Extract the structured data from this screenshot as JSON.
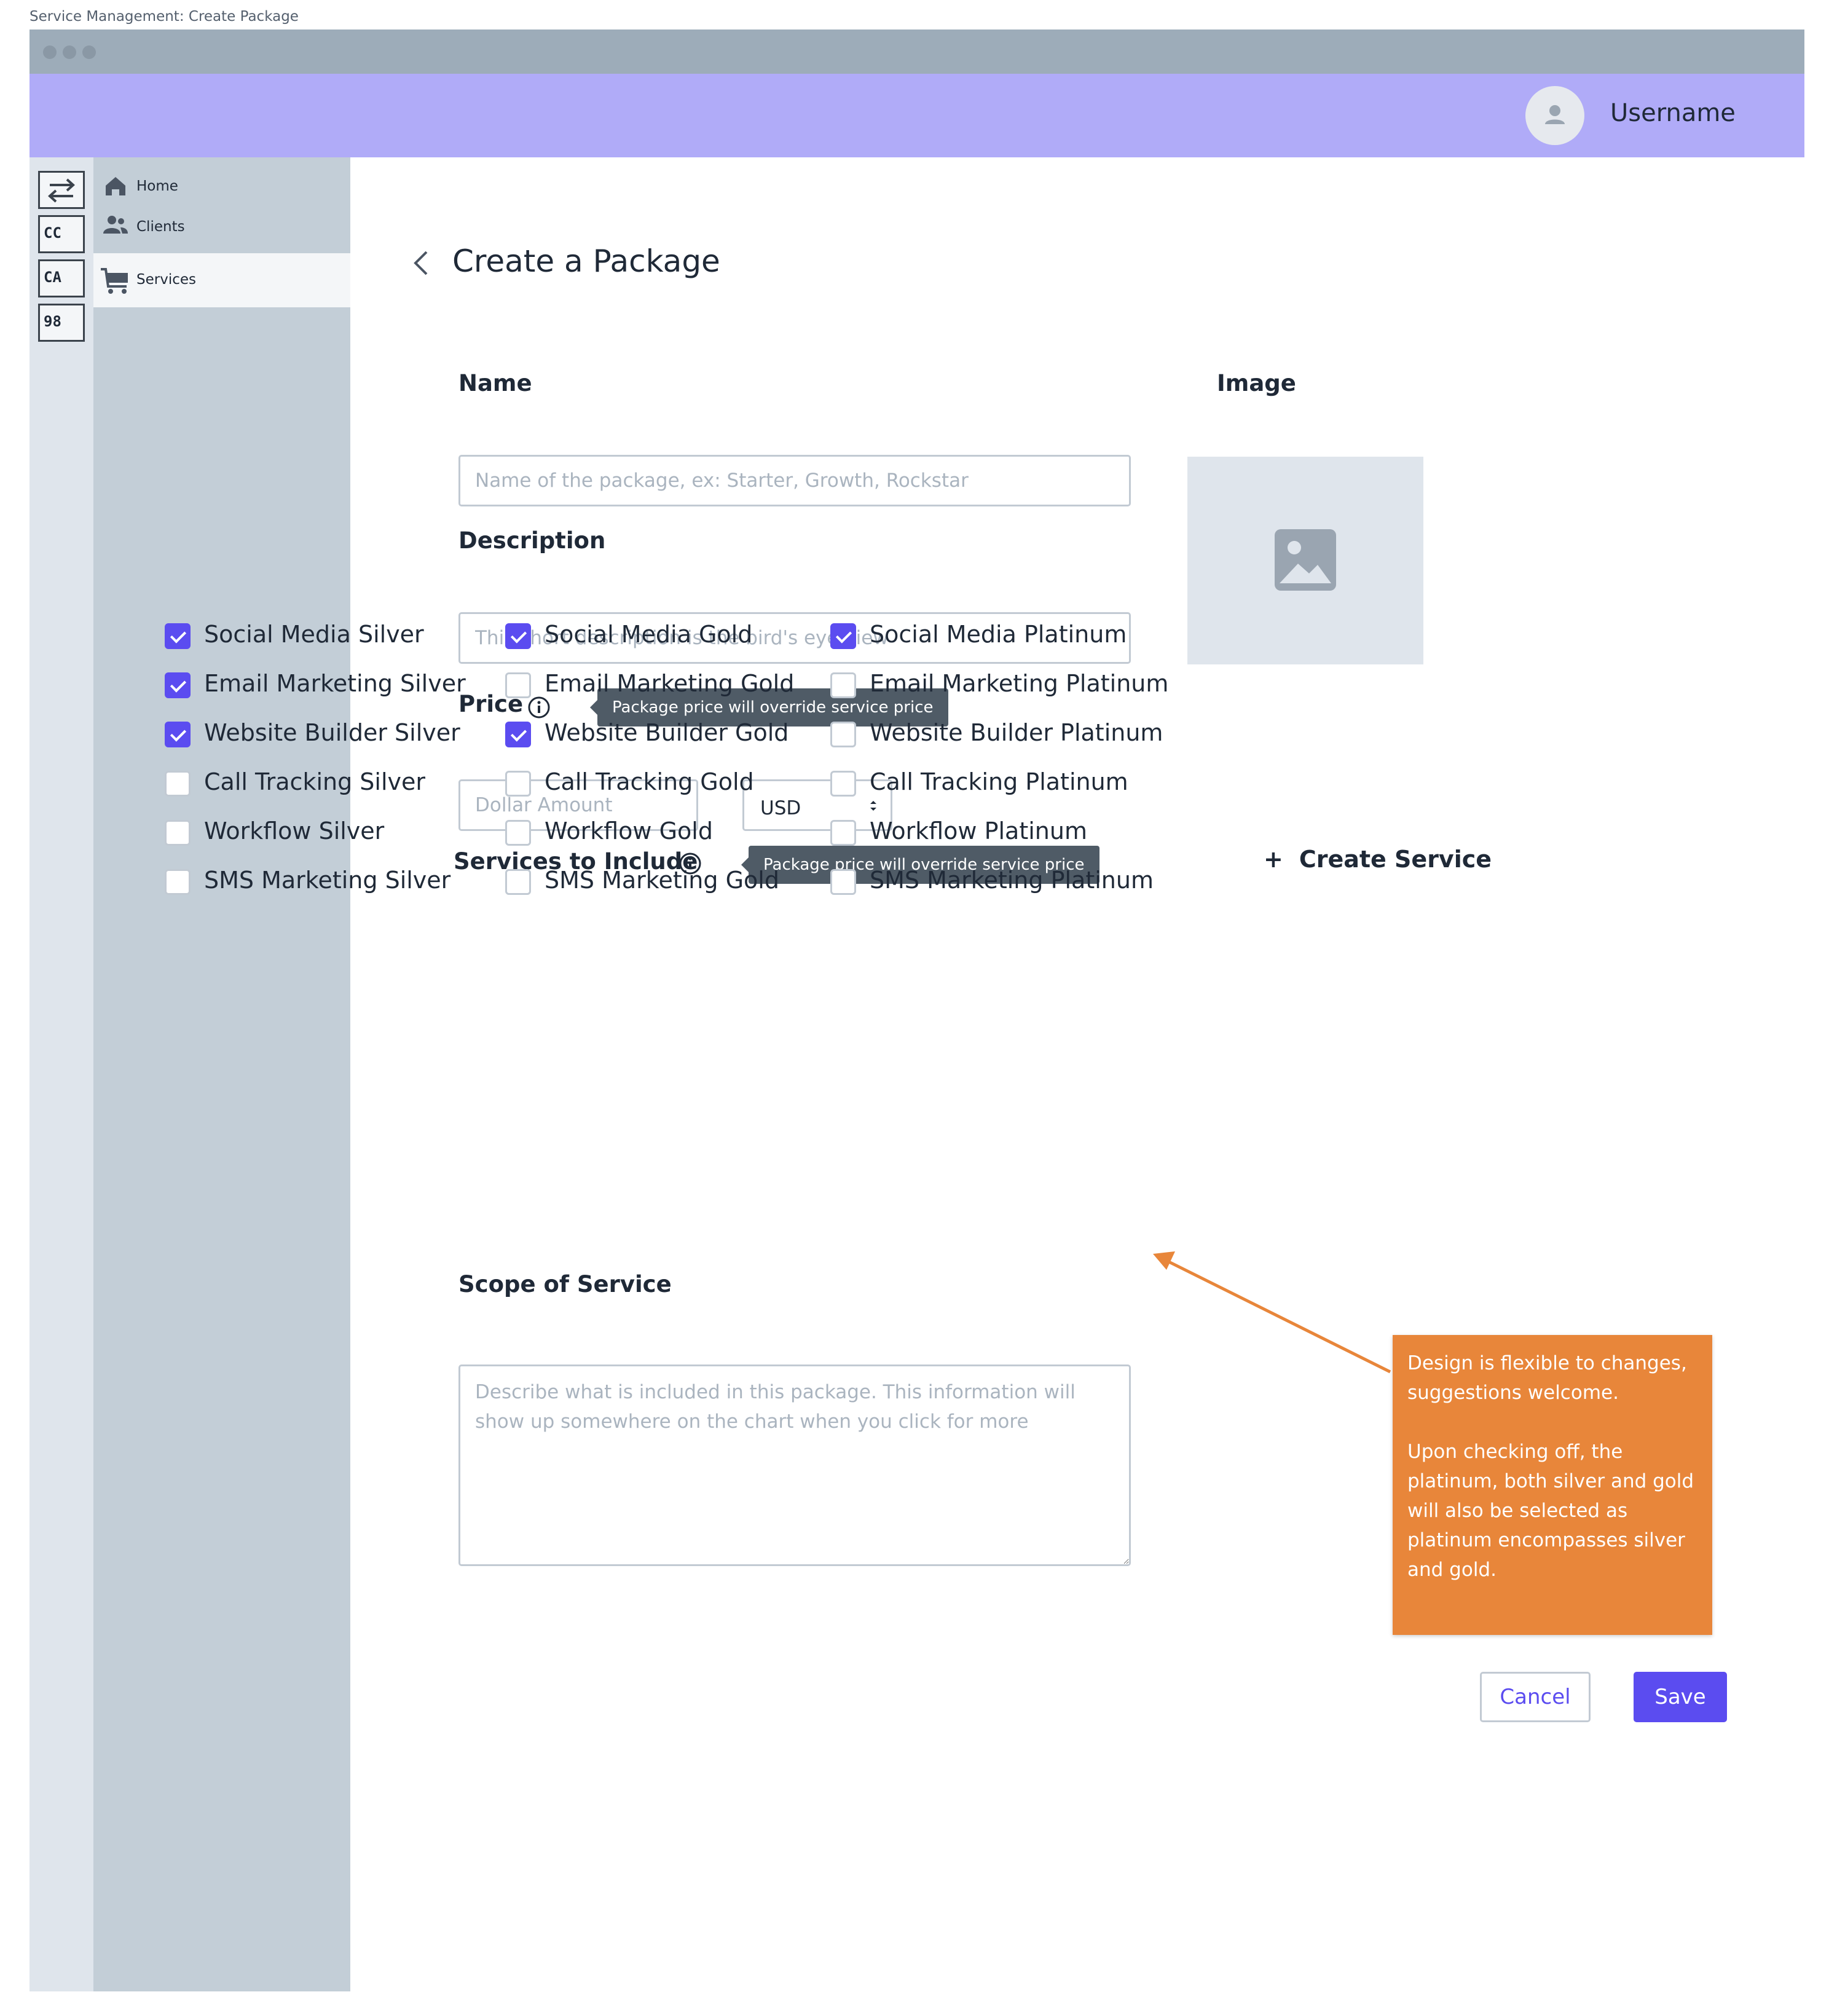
{
  "caption": "Service Management: Create Package",
  "header": {
    "username": "Username"
  },
  "rail": {
    "items": [
      "CC",
      "CA",
      "98"
    ]
  },
  "sidebar": {
    "items": [
      {
        "label": "Home"
      },
      {
        "label": "Clients"
      },
      {
        "label": "Services"
      }
    ],
    "active": "Services"
  },
  "page": {
    "title": "Create a Package"
  },
  "form": {
    "name": {
      "label": "Name",
      "placeholder": "Name of the package, ex: Starter, Growth, Rockstar"
    },
    "description": {
      "label": "Description",
      "placeholder": "This short description is the bird's eye view"
    },
    "image": {
      "label": "Image"
    },
    "price": {
      "label": "Price",
      "tooltip": "Package price will override service price",
      "placeholder": "Dollar Amount",
      "currency": "USD",
      "currency_options": [
        "USD"
      ]
    },
    "services": {
      "label": "Services to Include",
      "tooltip": "Package price will override service price",
      "create_label": "Create Service",
      "columns": [
        [
          {
            "label": "Social Media Silver",
            "checked": true
          },
          {
            "label": "Email Marketing Silver",
            "checked": true
          },
          {
            "label": "Website Builder Silver",
            "checked": true
          },
          {
            "label": "Call Tracking Silver",
            "checked": false
          },
          {
            "label": "Workflow Silver",
            "checked": false
          },
          {
            "label": "SMS Marketing Silver",
            "checked": false
          }
        ],
        [
          {
            "label": "Social Media Gold",
            "checked": true
          },
          {
            "label": "Email Marketing Gold",
            "checked": false
          },
          {
            "label": "Website Builder Gold",
            "checked": true
          },
          {
            "label": "Call Tracking Gold",
            "checked": false
          },
          {
            "label": "Workflow Gold",
            "checked": false
          },
          {
            "label": "SMS Marketing Gold",
            "checked": false
          }
        ],
        [
          {
            "label": "Social Media Platinum",
            "checked": true
          },
          {
            "label": "Email Marketing Platinum",
            "checked": false
          },
          {
            "label": "Website Builder Platinum",
            "checked": false
          },
          {
            "label": "Call Tracking Platinum",
            "checked": false
          },
          {
            "label": "Workflow Platinum",
            "checked": false
          },
          {
            "label": "SMS Marketing Platinum",
            "checked": false
          }
        ]
      ]
    },
    "scope": {
      "label": "Scope of Service",
      "placeholder": "Describe what is included in this package. This information will show up somewhere on the chart when you click for more"
    }
  },
  "annotation": {
    "paragraphs": [
      "Design is flexible to changes, suggestions welcome.",
      "Upon checking off, the platinum, both silver and gold will also be selected as platinum encompasses silver and gold."
    ]
  },
  "actions": {
    "cancel": "Cancel",
    "save": "Save"
  },
  "colors": {
    "accent": "#5b4cf0",
    "header": "#b0abf8",
    "sidebar": "#c3ced7",
    "note": "#e8863a",
    "tooltip": "#4f5b66"
  }
}
